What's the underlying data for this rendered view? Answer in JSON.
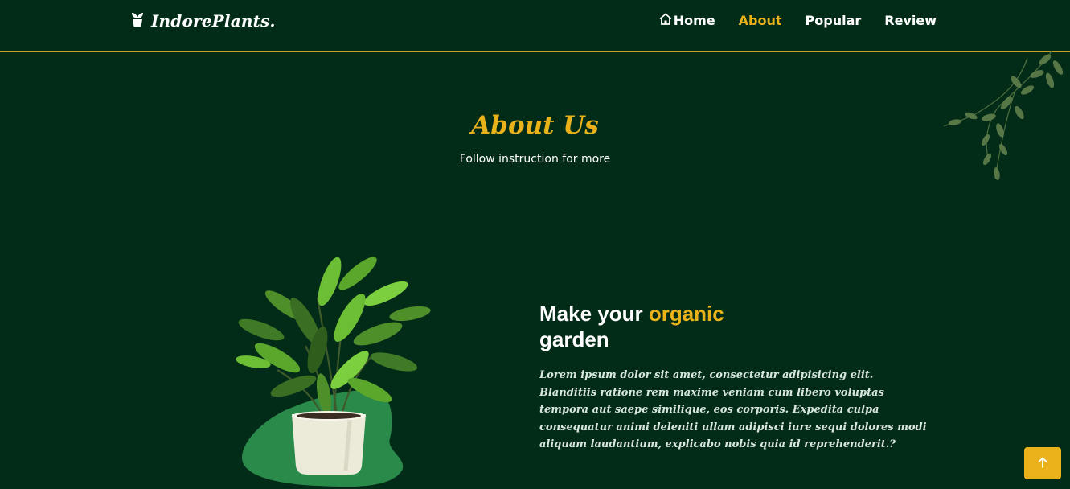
{
  "brand": {
    "name": "IndorePlants.",
    "icon": "plant-pot-icon"
  },
  "nav": {
    "items": [
      {
        "label": "Home",
        "icon": "home-icon"
      },
      {
        "label": "About"
      },
      {
        "label": "Popular"
      },
      {
        "label": "Review"
      }
    ],
    "active": "About"
  },
  "about": {
    "title": "About Us",
    "subtitle": "Follow instruction for more",
    "headline_part1": "Make your ",
    "headline_accent": "organic",
    "headline_part2": "garden",
    "body": "Lorem ipsum dolor sit amet, consectetur adipisicing elit. Blanditiis ratione rem maxime veniam cum libero voluptas tempora aut saepe similique, eos corporis. Expedita culpa consequatur animi deleniti ullam adipisci iure sequi dolores modi aliquam laudantium, explicabo nobis quia id reprehenderit.?"
  },
  "scroll_button": {
    "icon": "arrow-up-icon"
  },
  "colors": {
    "background": "#032c18",
    "accent": "#e9b21a",
    "blob": "#2a8a4a"
  }
}
